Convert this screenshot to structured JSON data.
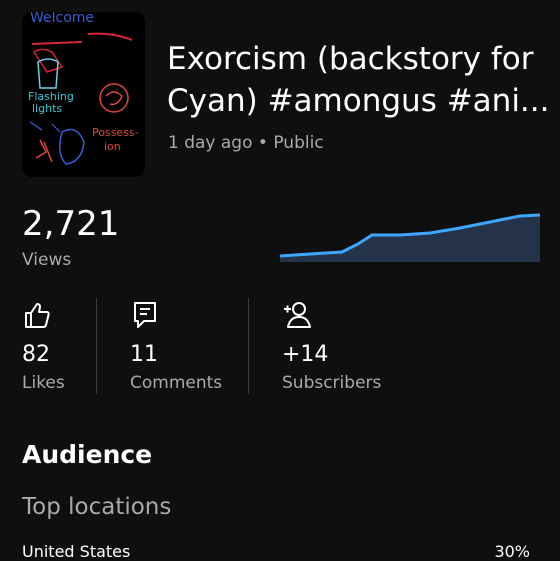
{
  "video": {
    "title_line1": "Exorcism (backstory for",
    "title_line2": "Cyan) #amongus #ani...",
    "age": "1 day ago",
    "separator": "•",
    "visibility": "Public",
    "thumbnail_text": {
      "top": "Welcome",
      "flashing": "Flashing",
      "lights": "lights",
      "possess": "Possess-",
      "ion": "ion"
    }
  },
  "views": {
    "count": "2,721",
    "label": "Views"
  },
  "stats": {
    "likes": {
      "count": "82",
      "label": "Likes",
      "icon": "thumbs-up-icon"
    },
    "comments": {
      "count": "11",
      "label": "Comments",
      "icon": "comment-icon"
    },
    "subscribers": {
      "count": "+14",
      "label": "Subscribers",
      "icon": "add-person-icon"
    }
  },
  "audience": {
    "title": "Audience",
    "top_locations_label": "Top locations",
    "locations": [
      {
        "country": "United States",
        "percent": "30%"
      }
    ]
  },
  "colors": {
    "background": "#0f0f0f",
    "accent": "#3ea6ff",
    "secondary_text": "#aaaaaa"
  }
}
